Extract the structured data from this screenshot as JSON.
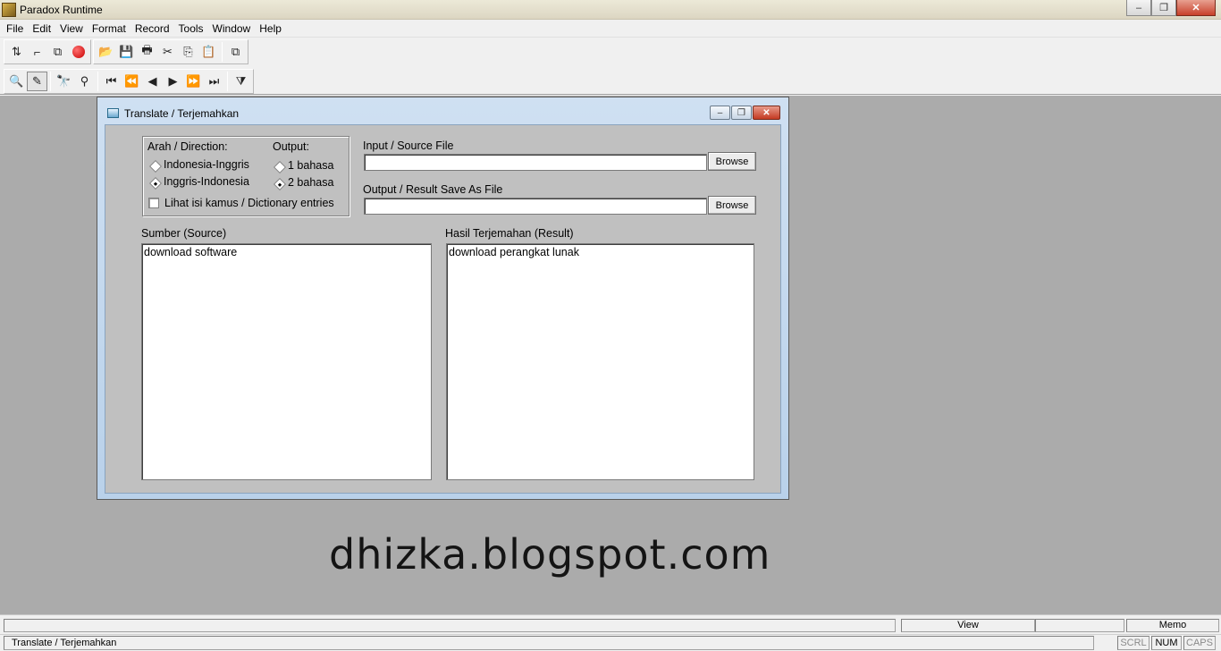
{
  "app": {
    "title": "Paradox Runtime"
  },
  "window_controls": {
    "minimize": "–",
    "restore": "❐",
    "close": "✕"
  },
  "menu": [
    "File",
    "Edit",
    "View",
    "Format",
    "Record",
    "Tools",
    "Window",
    "Help"
  ],
  "toolbar1": {
    "icons": [
      {
        "name": "sort-icon",
        "glyph": "⇅"
      },
      {
        "name": "line-icon",
        "glyph": "⌐"
      },
      {
        "name": "copy-record-icon",
        "glyph": "⧉"
      },
      {
        "name": "record-icon",
        "glyph": ""
      },
      {
        "name": "open-folder-icon",
        "glyph": "📂"
      },
      {
        "name": "save-icon",
        "glyph": "💾"
      },
      {
        "name": "print-icon",
        "glyph": "🖶"
      },
      {
        "name": "cut-icon",
        "glyph": "✂"
      },
      {
        "name": "copy-icon",
        "glyph": "⎘"
      },
      {
        "name": "paste-icon",
        "glyph": "📋"
      },
      {
        "name": "paste-special-icon",
        "glyph": "⧉"
      }
    ]
  },
  "toolbar2": {
    "icons": [
      {
        "name": "view-data-icon",
        "glyph": "🔍"
      },
      {
        "name": "edit-data-icon",
        "glyph": "✎"
      },
      {
        "name": "locate-icon",
        "glyph": "🔭"
      },
      {
        "name": "locate-next-icon",
        "glyph": "⚲"
      },
      {
        "name": "first-record-icon",
        "glyph": "⏮"
      },
      {
        "name": "previous-set-icon",
        "glyph": "⏪"
      },
      {
        "name": "previous-record-icon",
        "glyph": "◀"
      },
      {
        "name": "next-record-icon",
        "glyph": "▶"
      },
      {
        "name": "next-set-icon",
        "glyph": "⏩"
      },
      {
        "name": "last-record-icon",
        "glyph": "⏭"
      },
      {
        "name": "filter-icon",
        "glyph": "⧩"
      }
    ]
  },
  "dialog": {
    "title": "Translate / Terjemahkan",
    "direction_label": "Arah / Direction:",
    "direction_options": [
      "Indonesia-Inggris",
      "Inggris-Indonesia"
    ],
    "direction_selected": 1,
    "output_label": "Output:",
    "output_options": [
      "1 bahasa",
      "2 bahasa"
    ],
    "output_selected": 1,
    "dictionary_checkbox": "Lihat isi kamus / Dictionary entries",
    "dictionary_checked": false,
    "input_file_label": "Input / Source File",
    "input_file_value": "",
    "output_file_label": "Output / Result Save As File",
    "output_file_value": "",
    "browse_label": "Browse",
    "source_label": "Sumber (Source)",
    "source_text": "download software",
    "result_label": "Hasil Terjemahan (Result)",
    "result_text": "download perangkat lunak"
  },
  "watermark": "dhizka.blogspot.com",
  "status": {
    "mode": "View",
    "field_type": "Memo",
    "window_name": "Translate / Terjemahkan",
    "indicators": [
      "SCRL",
      "NUM",
      "CAPS"
    ],
    "indicator_active": [
      false,
      true,
      false
    ]
  }
}
